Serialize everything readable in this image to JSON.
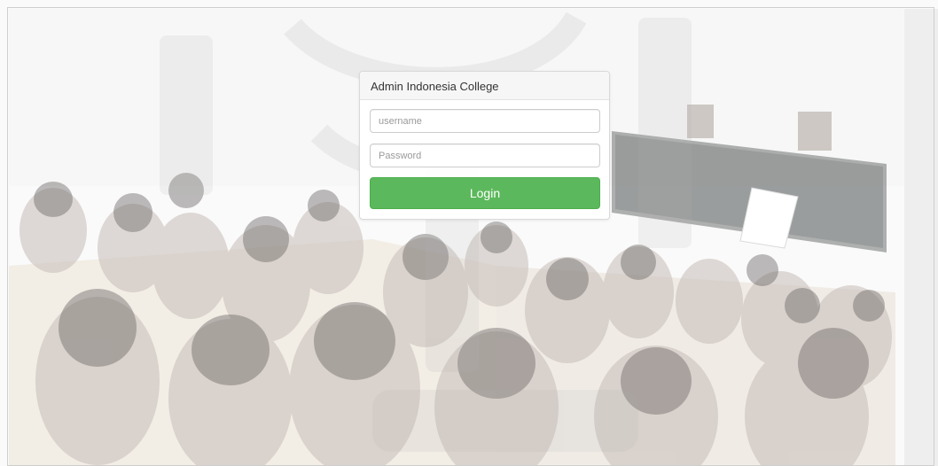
{
  "login": {
    "title": "Admin Indonesia College",
    "username_placeholder": "username",
    "username_value": "",
    "password_placeholder": "Password",
    "password_value": "",
    "login_label": "Login"
  },
  "colors": {
    "login_button": "#5cb85c",
    "panel_background": "#ffffff",
    "background_tint": "#f7f7f7"
  },
  "background": {
    "description_icon": "classroom-photo-icon"
  }
}
